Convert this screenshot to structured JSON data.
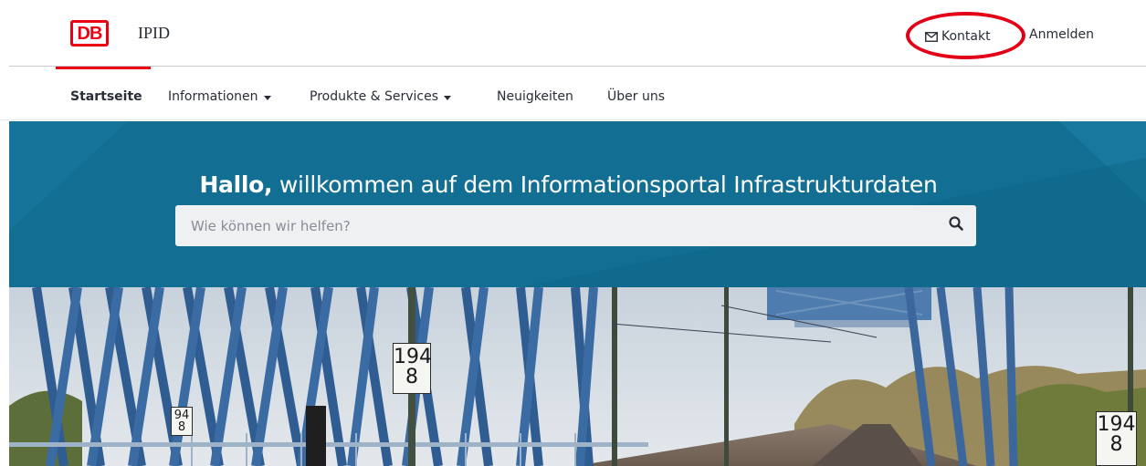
{
  "header": {
    "logo_text": "DB",
    "app_title": "IPID",
    "contact_label": "Kontakt",
    "login_label": "Anmelden"
  },
  "nav": {
    "items": [
      {
        "label": "Startseite",
        "active": true,
        "has_dropdown": false
      },
      {
        "label": "Informationen",
        "active": false,
        "has_dropdown": true
      },
      {
        "label": "Produkte & Services",
        "active": false,
        "has_dropdown": true
      },
      {
        "label": "Neuigkeiten",
        "active": false,
        "has_dropdown": false
      },
      {
        "label": "Über uns",
        "active": false,
        "has_dropdown": false
      }
    ]
  },
  "hero": {
    "greeting": "Hallo,",
    "title_rest": " willkommen auf dem Informationsportal Infrastrukturdaten",
    "search": {
      "value": "",
      "placeholder": "Wie können wir helfen?"
    }
  },
  "photo": {
    "signs": [
      {
        "top": "194",
        "bottom": "8"
      },
      {
        "top": "94",
        "bottom": "8"
      },
      {
        "top": "194",
        "bottom": "8"
      }
    ]
  },
  "icons": {
    "contact": "envelope-icon",
    "search": "search-icon",
    "dropdown": "caret-down-icon"
  },
  "colors": {
    "brand_red": "#ec0016",
    "hero_blue": "#126e93",
    "highlight_ring": "#e30016",
    "text": "#282d37"
  }
}
